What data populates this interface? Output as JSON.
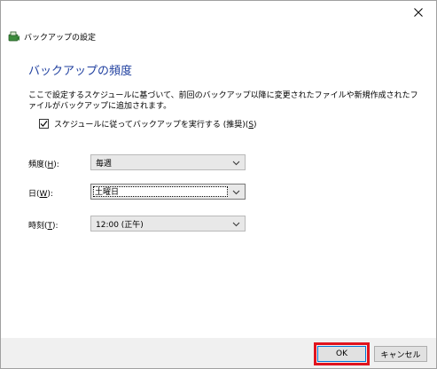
{
  "window": {
    "title": "バックアップの設定"
  },
  "heading": "バックアップの頻度",
  "description": "ここで設定するスケジュールに基づいて、前回のバックアップ以降に変更されたファイルや新規作成されたファイルがバックアップに追加されます。",
  "schedule_checkbox": {
    "label_prefix": "スケジュールに従ってバックアップを実行する (推奨)(",
    "accel": "S",
    "label_suffix": ")",
    "checked": true
  },
  "fields": {
    "frequency": {
      "label_prefix": "頻度(",
      "accel": "H",
      "label_suffix": "):",
      "value": "毎週"
    },
    "day": {
      "label_prefix": "日(",
      "accel": "W",
      "label_suffix": "):",
      "value": "土曜日"
    },
    "time": {
      "label_prefix": "時刻(",
      "accel": "T",
      "label_suffix": "):",
      "value": "12:00 (正午)"
    }
  },
  "buttons": {
    "ok": "OK",
    "cancel": "キャンセル"
  },
  "colors": {
    "heading": "#1f3f9f",
    "highlight": "#e0141e"
  },
  "icons": {
    "app": "backup-app-icon",
    "close": "close-icon",
    "dropdown": "chevron-down-icon",
    "check": "checkmark-icon"
  }
}
